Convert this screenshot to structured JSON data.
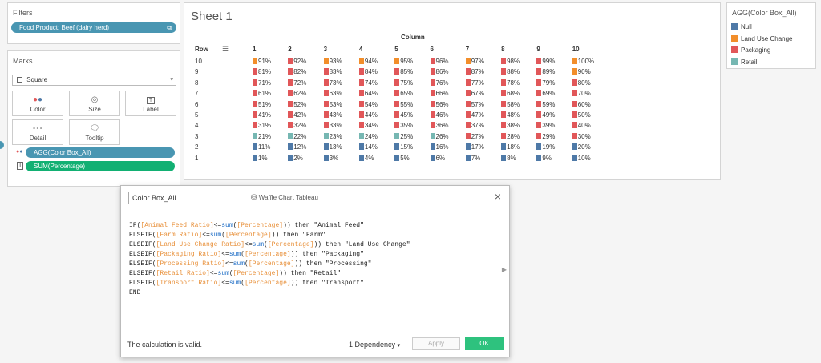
{
  "filters": {
    "title": "Filters",
    "pill": "Food Product: Beef (dairy herd)"
  },
  "marks": {
    "title": "Marks",
    "type_selected": "Square",
    "buttons": [
      {
        "label": "Color",
        "icon": "color-dots-icon"
      },
      {
        "label": "Size",
        "icon": "size-icon"
      },
      {
        "label": "Label",
        "icon": "label-icon"
      },
      {
        "label": "Detail",
        "icon": "detail-icon"
      },
      {
        "label": "Tooltip",
        "icon": "tooltip-icon"
      }
    ],
    "pills": [
      "AGG(Color Box_All)",
      "SUM(Percentage)"
    ]
  },
  "sheet": {
    "title": "Sheet 1",
    "row_header": "Row",
    "column_header": "Column",
    "columns": [
      "1",
      "2",
      "3",
      "4",
      "5",
      "6",
      "7",
      "8",
      "9",
      "10"
    ],
    "rows": [
      "10",
      "9",
      "8",
      "7",
      "6",
      "5",
      "4",
      "3",
      "2",
      "1"
    ]
  },
  "legend": {
    "title": "AGG(Color Box_All)",
    "items": [
      {
        "label": "Null",
        "color": "#4e79a7"
      },
      {
        "label": "Land Use Change",
        "color": "#f28e2b"
      },
      {
        "label": "Packaging",
        "color": "#e15759"
      },
      {
        "label": "Retail",
        "color": "#76b7b2"
      }
    ]
  },
  "chart_data": {
    "type": "table",
    "row_labels": [
      "10",
      "9",
      "8",
      "7",
      "6",
      "5",
      "4",
      "3",
      "2",
      "1"
    ],
    "column_labels": [
      "1",
      "2",
      "3",
      "4",
      "5",
      "6",
      "7",
      "8",
      "9",
      "10"
    ],
    "values": [
      [
        "91%",
        "92%",
        "93%",
        "94%",
        "95%",
        "96%",
        "97%",
        "98%",
        "99%",
        "100%"
      ],
      [
        "81%",
        "82%",
        "83%",
        "84%",
        "85%",
        "86%",
        "87%",
        "88%",
        "89%",
        "90%"
      ],
      [
        "71%",
        "72%",
        "73%",
        "74%",
        "75%",
        "76%",
        "77%",
        "78%",
        "79%",
        "80%"
      ],
      [
        "61%",
        "62%",
        "63%",
        "64%",
        "65%",
        "66%",
        "67%",
        "68%",
        "69%",
        "70%"
      ],
      [
        "51%",
        "52%",
        "53%",
        "54%",
        "55%",
        "56%",
        "57%",
        "58%",
        "59%",
        "60%"
      ],
      [
        "41%",
        "42%",
        "43%",
        "44%",
        "45%",
        "46%",
        "47%",
        "48%",
        "49%",
        "50%"
      ],
      [
        "31%",
        "32%",
        "33%",
        "34%",
        "35%",
        "36%",
        "37%",
        "38%",
        "39%",
        "40%"
      ],
      [
        "21%",
        "22%",
        "23%",
        "24%",
        "25%",
        "26%",
        "27%",
        "28%",
        "29%",
        "30%"
      ],
      [
        "11%",
        "12%",
        "13%",
        "14%",
        "15%",
        "16%",
        "17%",
        "18%",
        "19%",
        "20%"
      ],
      [
        "1%",
        "2%",
        "3%",
        "4%",
        "5%",
        "6%",
        "7%",
        "8%",
        "9%",
        "10%"
      ]
    ],
    "colors": [
      [
        "#f28e2b",
        "#e15759",
        "#f28e2b",
        "#f28e2b",
        "#f28e2b",
        "#e15759",
        "#f28e2b",
        "#e15759",
        "#e15759",
        "#f28e2b"
      ],
      [
        "#e15759",
        "#e15759",
        "#e15759",
        "#e15759",
        "#e15759",
        "#e15759",
        "#e15759",
        "#e15759",
        "#e15759",
        "#f28e2b"
      ],
      [
        "#e15759",
        "#e15759",
        "#e15759",
        "#e15759",
        "#e15759",
        "#e15759",
        "#e15759",
        "#e15759",
        "#e15759",
        "#e15759"
      ],
      [
        "#e15759",
        "#e15759",
        "#e15759",
        "#e15759",
        "#e15759",
        "#e15759",
        "#e15759",
        "#e15759",
        "#e15759",
        "#e15759"
      ],
      [
        "#e15759",
        "#e15759",
        "#e15759",
        "#e15759",
        "#e15759",
        "#e15759",
        "#e15759",
        "#e15759",
        "#e15759",
        "#e15759"
      ],
      [
        "#e15759",
        "#e15759",
        "#e15759",
        "#e15759",
        "#e15759",
        "#e15759",
        "#e15759",
        "#e15759",
        "#e15759",
        "#e15759"
      ],
      [
        "#e15759",
        "#e15759",
        "#e15759",
        "#e15759",
        "#e15759",
        "#e15759",
        "#e15759",
        "#e15759",
        "#e15759",
        "#e15759"
      ],
      [
        "#76b7b2",
        "#76b7b2",
        "#76b7b2",
        "#76b7b2",
        "#76b7b2",
        "#76b7b2",
        "#e15759",
        "#e15759",
        "#e15759",
        "#e15759"
      ],
      [
        "#4e79a7",
        "#4e79a7",
        "#4e79a7",
        "#4e79a7",
        "#4e79a7",
        "#4e79a7",
        "#4e79a7",
        "#4e79a7",
        "#4e79a7",
        "#4e79a7"
      ],
      [
        "#4e79a7",
        "#4e79a7",
        "#4e79a7",
        "#4e79a7",
        "#4e79a7",
        "#4e79a7",
        "#4e79a7",
        "#4e79a7",
        "#4e79a7",
        "#4e79a7"
      ]
    ]
  },
  "dialog": {
    "calc_name": "Color Box_All",
    "datasource": "Waffle Chart Tableau",
    "code_lines": [
      [
        {
          "t": "IF(",
          "c": ""
        },
        {
          "t": "[Animal Feed Ratio]",
          "c": "f"
        },
        {
          "t": "<=",
          "c": ""
        },
        {
          "t": "sum",
          "c": "k"
        },
        {
          "t": "(",
          "c": ""
        },
        {
          "t": "[Percentage]",
          "c": "f"
        },
        {
          "t": ")) then \"Animal Feed\"",
          "c": ""
        }
      ],
      [
        {
          "t": "ELSEIF(",
          "c": ""
        },
        {
          "t": "[Farm Ratio]",
          "c": "f"
        },
        {
          "t": "<=",
          "c": ""
        },
        {
          "t": "sum",
          "c": "k"
        },
        {
          "t": "(",
          "c": ""
        },
        {
          "t": "[Percentage]",
          "c": "f"
        },
        {
          "t": ")) then \"Farm\"",
          "c": ""
        }
      ],
      [
        {
          "t": "ELSEIF(",
          "c": ""
        },
        {
          "t": "[Land Use Change Ratio]",
          "c": "f"
        },
        {
          "t": "<=",
          "c": ""
        },
        {
          "t": "sum",
          "c": "k"
        },
        {
          "t": "(",
          "c": ""
        },
        {
          "t": "[Percentage]",
          "c": "f"
        },
        {
          "t": ")) then \"Land Use Change\"",
          "c": ""
        }
      ],
      [
        {
          "t": "ELSEIF(",
          "c": ""
        },
        {
          "t": "[Packaging Ratio]",
          "c": "f"
        },
        {
          "t": "<=",
          "c": ""
        },
        {
          "t": "sum",
          "c": "k"
        },
        {
          "t": "(",
          "c": ""
        },
        {
          "t": "[Percentage]",
          "c": "f"
        },
        {
          "t": ")) then \"Packaging\"",
          "c": ""
        }
      ],
      [
        {
          "t": "ELSEIF(",
          "c": ""
        },
        {
          "t": "[Processing Ratio]",
          "c": "f"
        },
        {
          "t": "<=",
          "c": ""
        },
        {
          "t": "sum",
          "c": "k"
        },
        {
          "t": "(",
          "c": ""
        },
        {
          "t": "[Percentage]",
          "c": "f"
        },
        {
          "t": ")) then \"Processing\"",
          "c": ""
        }
      ],
      [
        {
          "t": "ELSEIF(",
          "c": ""
        },
        {
          "t": "[Retail Ratio]",
          "c": "f"
        },
        {
          "t": "<=",
          "c": ""
        },
        {
          "t": "sum",
          "c": "k"
        },
        {
          "t": "(",
          "c": ""
        },
        {
          "t": "[Percentage]",
          "c": "f"
        },
        {
          "t": ")) then \"Retail\"",
          "c": ""
        }
      ],
      [
        {
          "t": "ELSEIF(",
          "c": ""
        },
        {
          "t": "[Transport Ratio]",
          "c": "f"
        },
        {
          "t": "<=",
          "c": ""
        },
        {
          "t": "sum",
          "c": "k"
        },
        {
          "t": "(",
          "c": ""
        },
        {
          "t": "[Percentage]",
          "c": "f"
        },
        {
          "t": ")) then \"Transport\"",
          "c": ""
        }
      ],
      [
        {
          "t": "END",
          "c": ""
        }
      ]
    ],
    "status": "The calculation is valid.",
    "dependency": "1 Dependency",
    "apply": "Apply",
    "ok": "OK",
    "ok_color": "#2ec27e"
  }
}
